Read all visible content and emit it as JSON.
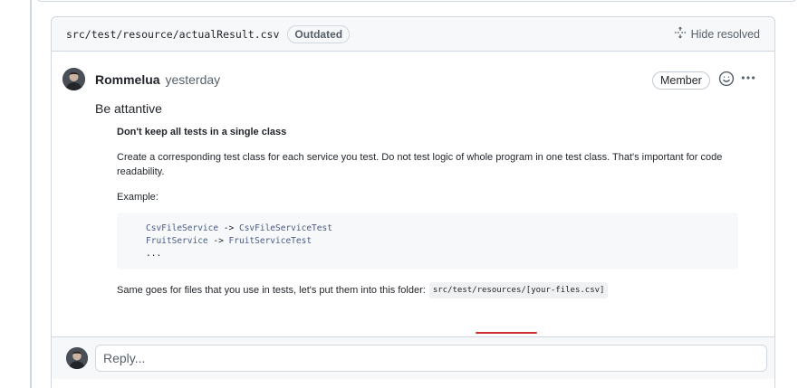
{
  "thread": {
    "file_path": "src/test/resource/actualResult.csv",
    "outdated_label": "Outdated",
    "hide_resolved_label": "Hide resolved"
  },
  "comment": {
    "author": "Rommelua",
    "time": "yesterday",
    "role_badge": "Member",
    "text": "Be attantive",
    "quote": {
      "title": "Don't keep all tests in a single class",
      "paragraph": "Create a corresponding test class for each service you test. Do not test logic of whole program in one test class. That's important for code readability.",
      "example_label": "Example:",
      "code_lines": [
        {
          "left": "CsvFileService",
          "arrow": " -> ",
          "right": "CsvFileServiceTest"
        },
        {
          "left": "FruitService",
          "arrow": " -> ",
          "right": "FruitServiceTest"
        },
        {
          "left": "...",
          "arrow": "",
          "right": ""
        }
      ],
      "same_goes_text": "Same goes for files that you use in tests, let's put them into this folder:",
      "folder_code": "src/test/resources/[your-files.csv]"
    }
  },
  "reply": {
    "placeholder": "Reply..."
  },
  "icons": {
    "hide_resolved": "fold-icon",
    "emoji": "smiley-icon",
    "more": "kebab-horizontal-icon"
  },
  "colors": {
    "underline_annotation": "#d12f2f",
    "border": "#d0d7de"
  }
}
